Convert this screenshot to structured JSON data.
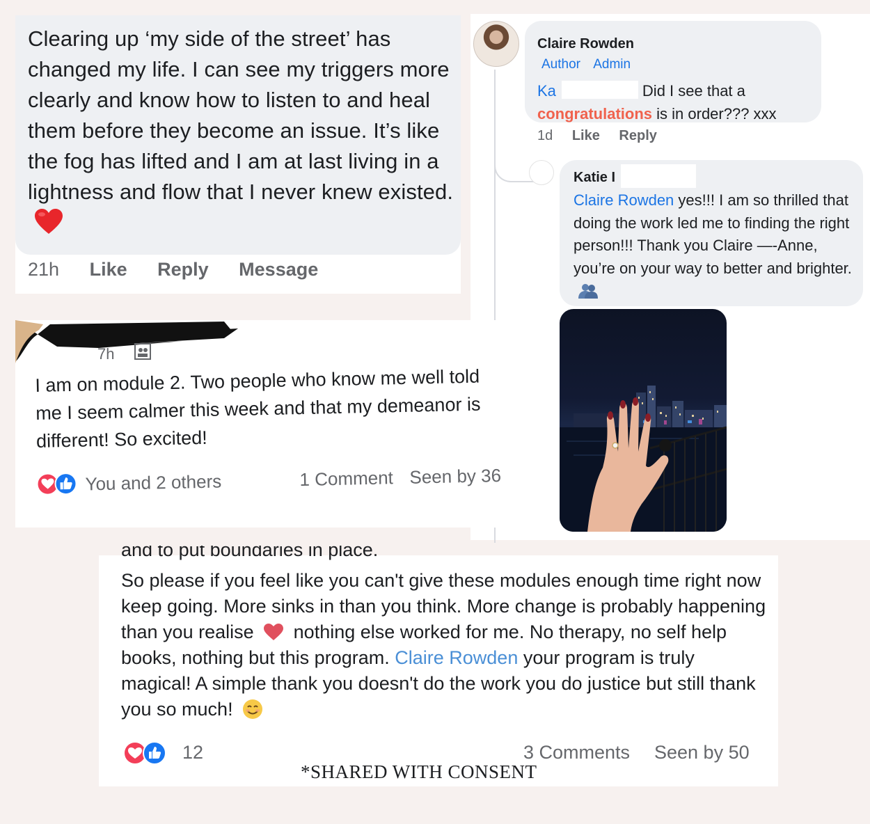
{
  "panel_top_left": {
    "text": "Clearing up ‘my side of the street’ has changed my life. I can see my triggers more clearly and know how to listen to and heal them before they become an issue. It’s like the fog has lifted and I am at last living in a lightness and flow that I never knew existed.",
    "emoji": "red-heart",
    "time": "21h",
    "like": "Like",
    "reply": "Reply",
    "message": "Message"
  },
  "panel_top_right": {
    "comment1": {
      "author": "Claire Rowden",
      "badge_author": "Author",
      "badge_admin": "Admin",
      "mention": "Ka",
      "text_part1": "Did I see that a",
      "highlight": "congratulations",
      "text_part2": "is in order??? xxx",
      "time": "1d",
      "like": "Like",
      "reply": "Reply"
    },
    "comment2": {
      "author": "Katie I",
      "mention": "Claire Rowden",
      "text": "yes!!! I am so thrilled that doing the work led me to finding the right person!!! Thank you Claire —-Anne, you’re on your way to better and brighter."
    }
  },
  "panel_middle_left": {
    "timestamp": "7h",
    "text": "I am on module 2. Two people who know me well told me I seem calmer this week and that my demeanor is different! So excited!",
    "reactions": "You and 2 others",
    "comments": "1 Comment",
    "seen": "Seen by 36"
  },
  "panel_bottom": {
    "cutoff_text": "and to put boundaries in place.",
    "text_part1": "So please if you feel like you can't give these modules enough time right now keep going. More sinks in than you think. More change is probably happening than you realise",
    "text_part2": "nothing else worked for me. No therapy, no self help books, nothing but this program.",
    "mention": "Claire Rowden",
    "text_part3": "your program is truly magical! A simple thank you doesn't do the work you do justice but still thank you so much!",
    "reaction_count": "12",
    "comments": "3 Comments",
    "seen": "Seen by 50",
    "consent_note": "*SHARED WITH CONSENT"
  },
  "colors": {
    "facebook_blue": "#1b74e4",
    "congrats_red": "#f0624d",
    "bubble_grey": "#eef0f3",
    "muted_text": "#65676b",
    "page_background": "#f7f1ef"
  }
}
